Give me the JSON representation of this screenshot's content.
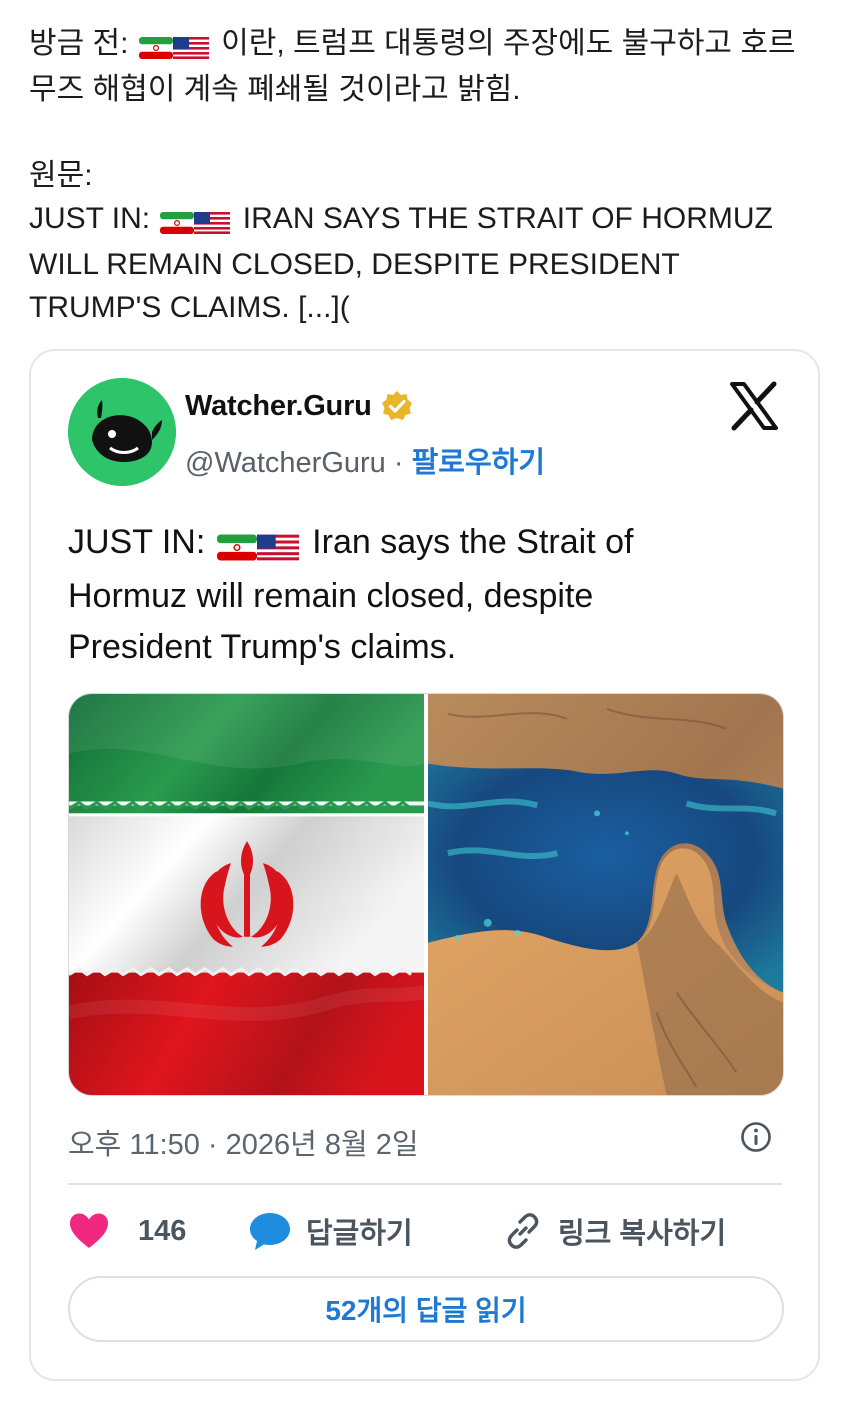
{
  "post": {
    "line1": "방금 전: ",
    "line1_tail": " 이란, 트럼프 대통령의 주장에도 불구하고 호르",
    "line2": "무즈 해협이 계속 폐쇄될 것이라고 밝힘.",
    "original_label": "원문:",
    "orig1": "JUST IN: ",
    "orig1_tail": " IRAN SAYS THE STRAIT OF HORMUZ",
    "orig2": "WILL REMAIN CLOSED, DESPITE PRESIDENT",
    "orig3": "TRUMP'S CLAIMS. [...]("
  },
  "embed": {
    "name": "Watcher.Guru",
    "handle": "@WatcherGuru",
    "separator": " · ",
    "follow": "팔로우하기",
    "text1": "JUST IN: ",
    "text1_tail": " Iran says the Strait of",
    "text2": "Hormuz will remain closed, despite",
    "text3": "President Trump's claims.",
    "timestamp": "오후 11:50 · 2026년 8월 2일",
    "like_count": "146",
    "reply_label": "답글하기",
    "copy_link_label": "링크 복사하기",
    "read_replies_label": "52개의 답글 읽기"
  },
  "icons": {
    "flags": [
      "iran-flag-icon",
      "us-flag-icon"
    ],
    "verified": "verified-badge-icon",
    "platform": "x-logo-icon",
    "info": "info-icon",
    "like": "heart-icon",
    "reply": "speech-bubble-icon",
    "link": "link-icon"
  },
  "colors": {
    "accent_blue": "#1d79d4",
    "heart": "#f0287f",
    "reply_bubble": "#1e8de0",
    "avatar_green": "#2dc46a",
    "verified_gold": "#e9b52a"
  }
}
